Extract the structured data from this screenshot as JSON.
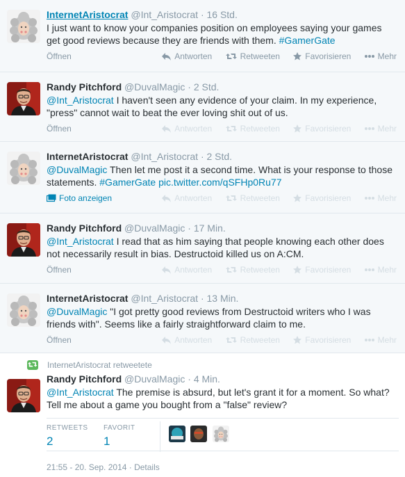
{
  "tweets": [
    {
      "fullname": "InternetAristocrat",
      "username": "@Int_Aristocrat",
      "time": "· 16 Std.",
      "text_parts": [
        "I just want to know your companies position on employees saying your games get good reviews because they are friends with them. ",
        "#GamerGate"
      ],
      "expand": "Öffnen"
    },
    {
      "fullname": "Randy Pitchford",
      "username": "@DuvalMagic",
      "time": "· 2 Std.",
      "mention": "@Int_Aristocrat",
      "text": " I haven't seen any evidence of your claim. In my experience, \"press\" cannot wait to beat the ever loving shit out of us.",
      "expand": "Öffnen"
    },
    {
      "fullname": "InternetAristocrat",
      "username": "@Int_Aristocrat",
      "time": "· 2 Std.",
      "mention": "@DuvalMagic",
      "text": " Then let me post it a second time.  What is your response to those statements.  ",
      "hashtag": "#GamerGate",
      "link": " pic.twitter.com/qSFHp0Ru77",
      "expand": "Foto anzeigen"
    },
    {
      "fullname": "Randy Pitchford",
      "username": "@DuvalMagic",
      "time": "· 17 Min.",
      "mention": "@Int_Aristocrat",
      "text": " I read that as him saying that people knowing each other does not necessarily result in bias. Destructoid killed us on A:CM.",
      "expand": "Öffnen"
    },
    {
      "fullname": "InternetAristocrat",
      "username": "@Int_Aristocrat",
      "time": "· 13 Min.",
      "mention": "@DuvalMagic",
      "text": " \"I got pretty good reviews from Destructoid writers who I was friends with\".  Seems like a fairly straightforward claim to me.",
      "expand": "Öffnen"
    }
  ],
  "actions": {
    "reply": "Antworten",
    "retweet": "Retweeten",
    "favorite": "Favorisieren",
    "more": "Mehr"
  },
  "main": {
    "context": "InternetAristocrat retweetete",
    "fullname": "Randy Pitchford",
    "username": "@DuvalMagic",
    "time": "· 4 Min.",
    "mention": "@Int_Aristocrat",
    "text": " The premise is absurd, but let's grant it for a moment. So what? Tell me about a game you bought from a \"false\" review?",
    "retweets_label": "RETWEETS",
    "retweets": "2",
    "favorites_label": "FAVORIT",
    "favorites": "1",
    "timestamp": "21:55 - 20. Sep. 2014 · Details"
  },
  "colors": {
    "link": "#0084b4",
    "muted": "#8899a6",
    "retweet_green": "#5cb85c"
  }
}
